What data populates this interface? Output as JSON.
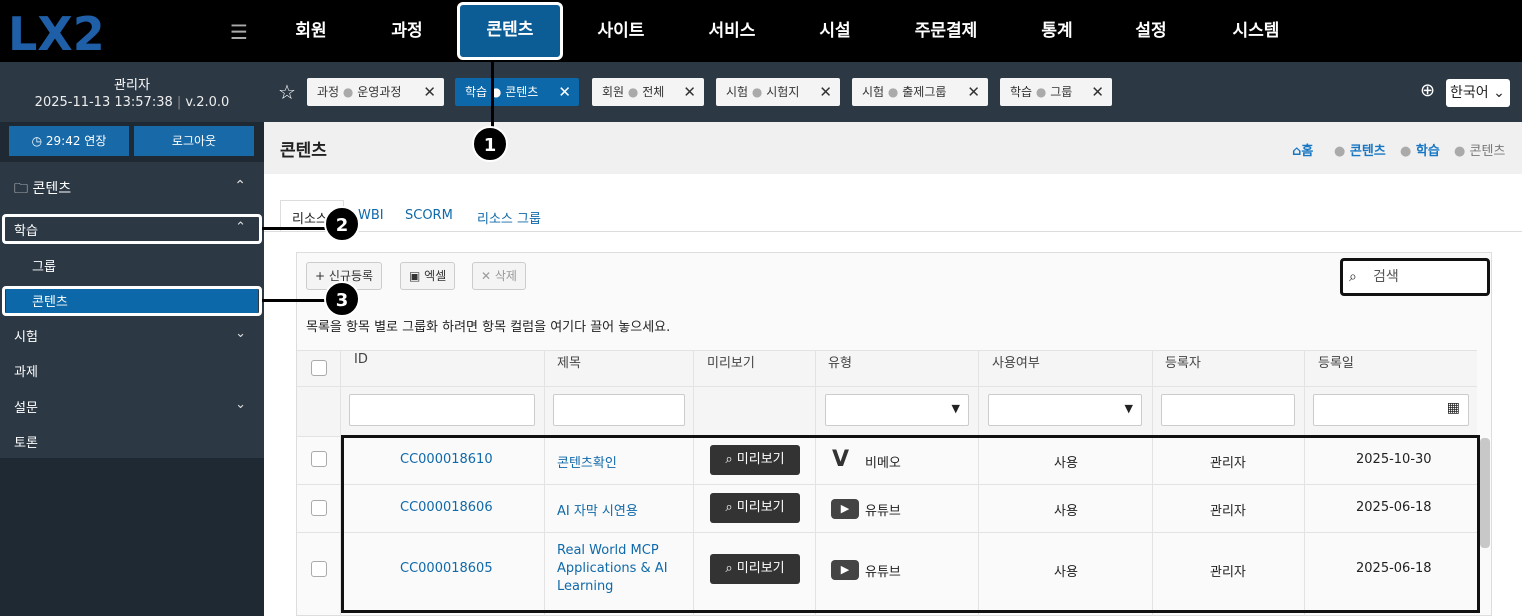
{
  "logo": {
    "text": "LX2"
  },
  "top_nav": [
    "회원",
    "과정",
    "콘텐츠",
    "사이트",
    "서비스",
    "시설",
    "주문결제",
    "통계",
    "설정",
    "시스템"
  ],
  "active_nav": "콘텐츠",
  "user": {
    "name": "관리자",
    "datetime": "2025-11-13 13:57:38",
    "version": "v.2.0.0"
  },
  "sidebar": {
    "extend_label": "29:42 연장",
    "logout_label": "로그아웃",
    "section": "콘텐츠",
    "items": [
      {
        "label": "학습",
        "expanded": true
      },
      {
        "label": "그룹",
        "sub": true
      },
      {
        "label": "콘텐츠",
        "sub": true,
        "active": true
      },
      {
        "label": "시험",
        "expanded": false
      },
      {
        "label": "과제"
      },
      {
        "label": "설문",
        "expanded": false
      },
      {
        "label": "토론"
      }
    ]
  },
  "open_tabs": [
    {
      "parent": "과정",
      "name": "운영과정"
    },
    {
      "parent": "학습",
      "name": "콘텐츠",
      "active": true
    },
    {
      "parent": "회원",
      "name": "전체"
    },
    {
      "parent": "시험",
      "name": "시험지"
    },
    {
      "parent": "시험",
      "name": "출제그룹"
    },
    {
      "parent": "학습",
      "name": "그룹"
    }
  ],
  "language": "한국어",
  "page": {
    "title": "콘텐츠",
    "breadcrumb": [
      "홈",
      "콘텐츠",
      "학습",
      "콘텐츠"
    ]
  },
  "sub_tabs": [
    "리소스",
    "WBI",
    "SCORM",
    "리소스 그룹"
  ],
  "toolbar": {
    "new": "신규등록",
    "excel": "엑셀",
    "delete": "삭제",
    "search_placeholder": "검색"
  },
  "group_hint": "목록을 항목 별로 그룹화 하려면 항목 컬럼을 여기다 끌어 놓으세요.",
  "columns": [
    "ID",
    "제목",
    "미리보기",
    "유형",
    "사용여부",
    "등록자",
    "등록일"
  ],
  "preview_label": "미리보기",
  "rows": [
    {
      "id": "CC000018610",
      "title": "콘텐츠확인",
      "type": "비메오",
      "use": "사용",
      "author": "관리자",
      "date": "2025-10-30"
    },
    {
      "id": "CC000018606",
      "title": "AI 자막 시연용",
      "type": "유튜브",
      "use": "사용",
      "author": "관리자",
      "date": "2025-06-18"
    },
    {
      "id": "CC000018605",
      "title": "Real World MCP Applications & AI Learning",
      "type": "유튜브",
      "use": "사용",
      "author": "관리자",
      "date": "2025-06-18"
    }
  ],
  "callouts": [
    "1",
    "2",
    "3"
  ]
}
